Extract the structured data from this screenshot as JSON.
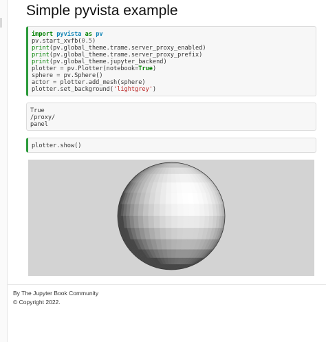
{
  "page": {
    "title": "Simple pyvista example"
  },
  "cells": {
    "cell1_code": {
      "line1": {
        "kw": "import",
        "mod": "pyvista",
        "as": "as",
        "alias": "pv"
      },
      "line2": {
        "pre": "pv.start_xvfb(",
        "num": "0.5",
        "post": ")"
      },
      "line3": {
        "fn": "print",
        "rest": "(pv.global_theme.trame.server_proxy_enabled)"
      },
      "line4": {
        "fn": "print",
        "rest": "(pv.global_theme.trame.server_proxy_prefix)"
      },
      "line5": {
        "fn": "print",
        "rest": "(pv.global_theme.jupyter_backend)"
      },
      "line6": {
        "pre": "plotter ",
        "eq": "=",
        "mid": " pv.Plotter(notebook",
        "eq2": "=",
        "bool": "True",
        "post": ")"
      },
      "line7": {
        "pre": "sphere ",
        "eq": "=",
        "post": " pv.Sphere()"
      },
      "line8": {
        "pre": "actor ",
        "eq": "=",
        "post": " plotter.add_mesh(sphere)"
      },
      "line9": {
        "pre": "plotter.set_background(",
        "str": "'lightgrey'",
        "post": ")"
      }
    },
    "cell1_output": [
      "True",
      "/proxy/",
      "panel"
    ],
    "cell2_code": {
      "line1": "plotter.show()"
    }
  },
  "plot": {
    "background": "#d3d3d3",
    "mesh": "sphere"
  },
  "footer": {
    "byline": "By The Jupyter Book Community",
    "copyright": "© Copyright 2022."
  },
  "colors": {
    "accent_green": "#2b9a3a",
    "keyword": "#008000",
    "module": "#0e84b5",
    "string": "#ba2121",
    "number": "#666666"
  }
}
